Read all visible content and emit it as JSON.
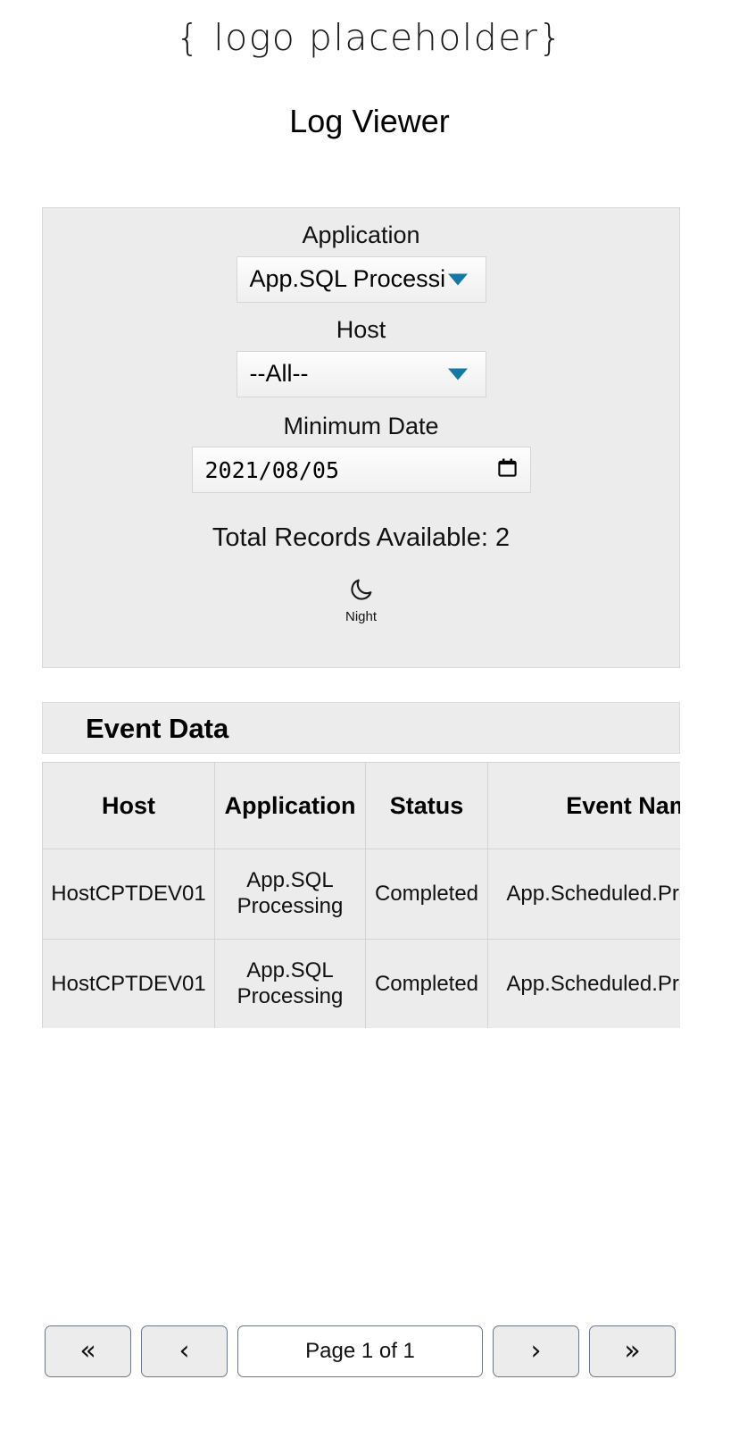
{
  "header": {
    "logo_placeholder": "{ logo placeholder}",
    "title": "Log Viewer"
  },
  "filters": {
    "application": {
      "label": "Application",
      "value": "App.SQL Processi",
      "full_value": "App.SQL Processing",
      "caret_icon": "chevron-down-icon"
    },
    "host": {
      "label": "Host",
      "value": "--All--",
      "caret_icon": "chevron-down-icon"
    },
    "minimum_date": {
      "label": "Minimum Date",
      "value": "2021/08/05",
      "picker_icon": "calendar-icon"
    },
    "total_records": "Total Records Available: 2",
    "theme_toggle": {
      "icon": "moon-icon",
      "label": "Night"
    }
  },
  "event_data": {
    "card_title": "Event Data",
    "columns": [
      "Host",
      "Application",
      "Status",
      "Event Name"
    ],
    "rows": [
      {
        "host": "HostCPTDEV01",
        "application": "App.SQL Processing",
        "status": "Completed",
        "event_name": "App.Scheduled.Processing"
      },
      {
        "host": "HostCPTDEV01",
        "application": "App.SQL Processing",
        "status": "Completed",
        "event_name": "App.Scheduled.Processing"
      }
    ]
  },
  "pagination": {
    "first_label": "«",
    "prev_label": "‹",
    "page_label": "Page 1 of 1",
    "next_label": "›",
    "last_label": "»"
  },
  "colors": {
    "status_completed": "#2bbb2b",
    "caret_blue": "#1579a8",
    "panel_bg": "#ececec"
  }
}
